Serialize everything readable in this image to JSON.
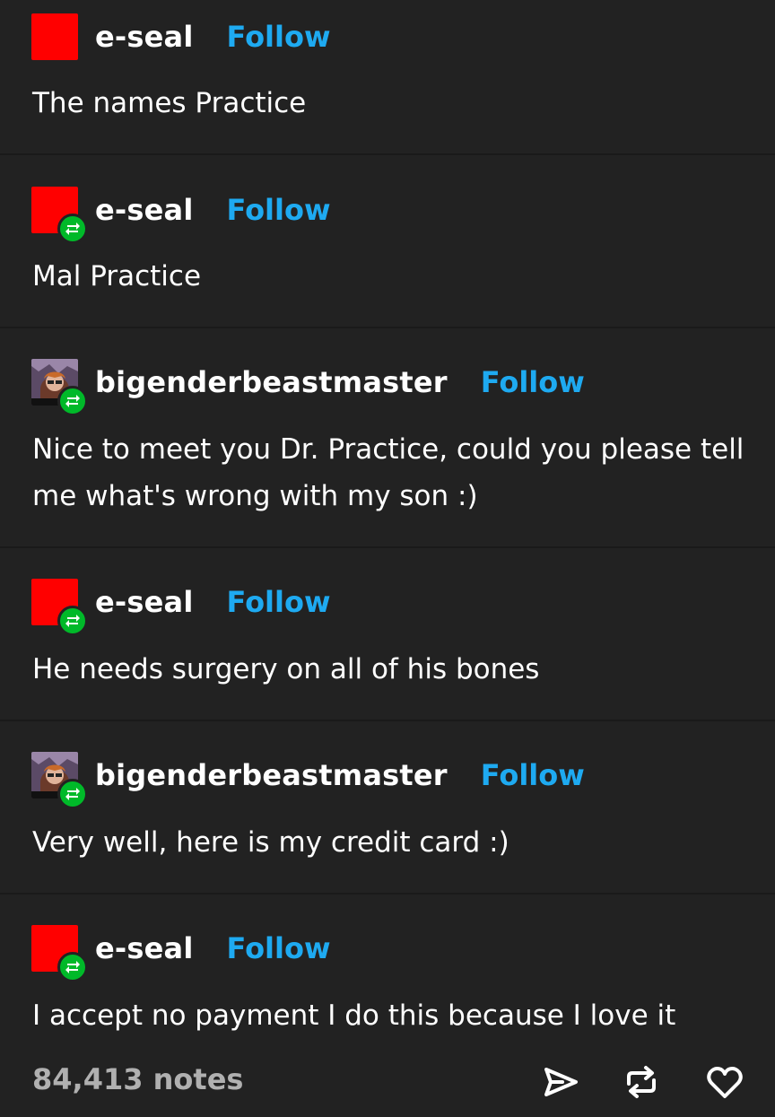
{
  "posts": [
    {
      "user": "e-seal",
      "follow": "Follow",
      "text": "The names Practice",
      "avatar": "red-square",
      "reblog": false
    },
    {
      "user": "e-seal",
      "follow": "Follow",
      "text": "Mal Practice",
      "avatar": "red-square",
      "reblog": true
    },
    {
      "user": "bigenderbeastmaster",
      "follow": "Follow",
      "text": "Nice to meet you Dr. Practice, could you please tell me what's wrong with my son :)",
      "avatar": "illustrated-character",
      "reblog": true
    },
    {
      "user": "e-seal",
      "follow": "Follow",
      "text": "He needs surgery on all of his bones",
      "avatar": "red-square",
      "reblog": true
    },
    {
      "user": "bigenderbeastmaster",
      "follow": "Follow",
      "text": "Very well, here is my credit card :)",
      "avatar": "illustrated-character",
      "reblog": true
    },
    {
      "user": "e-seal",
      "follow": "Follow",
      "text": "I accept no payment I do this because I love it",
      "avatar": "red-square",
      "reblog": true
    }
  ],
  "footer": {
    "notes": "84,413 notes",
    "icons": [
      "share-icon",
      "reblog-icon",
      "like-icon"
    ]
  },
  "colors": {
    "background": "#222222",
    "follow": "#1eaaf1",
    "reblog_badge": "#00b929",
    "avatar_red": "#ff0000",
    "notes": "#b0b0b0"
  }
}
